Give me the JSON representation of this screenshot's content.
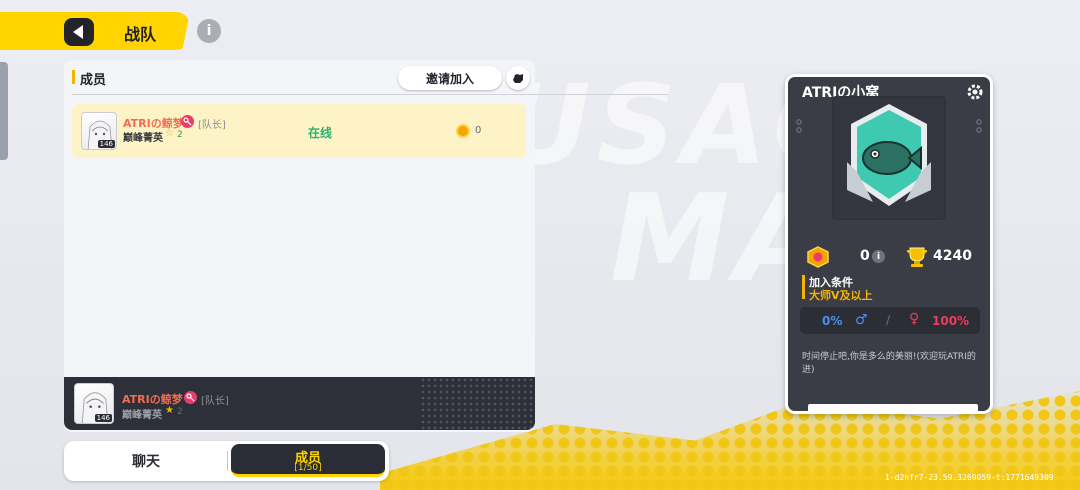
{
  "header": {
    "title": "战队"
  },
  "members_panel": {
    "section_title": "成员",
    "invite_label": "邀请加入",
    "members": [
      {
        "name": "ATRIの鲸梦",
        "role": "[队长]",
        "rank": "巅峰菁英",
        "stars": "2",
        "level": "146",
        "status": "在线",
        "score": "0"
      }
    ],
    "self": {
      "name": "ATRIの鲸梦",
      "role": "[队长]",
      "rank": "巅峰菁英",
      "stars": "2",
      "level": "146"
    }
  },
  "tabs": {
    "chat": "聊天",
    "members": "成员",
    "members_count": "[1/50]"
  },
  "team_card": {
    "name": "ATRIの小窝",
    "activity": "0",
    "trophies": "4240",
    "join_condition_label": "加入条件",
    "join_condition_value": "大师V及以上",
    "male_pct": "0%",
    "female_pct": "100%",
    "slash": "/",
    "description": "时间停止吧,你是多么的美丽!(欢迎玩ATRI的进)",
    "badge_color": "#3ec9b0"
  },
  "build_id": "1-d2nfr7-23.59.3269059-t:1771649309",
  "colors": {
    "accent_yellow": "#ffd400",
    "online_green": "#29b56a",
    "name_red": "#f26b52",
    "male_blue": "#4d8ff0",
    "female_pink": "#ee3b5c"
  }
}
